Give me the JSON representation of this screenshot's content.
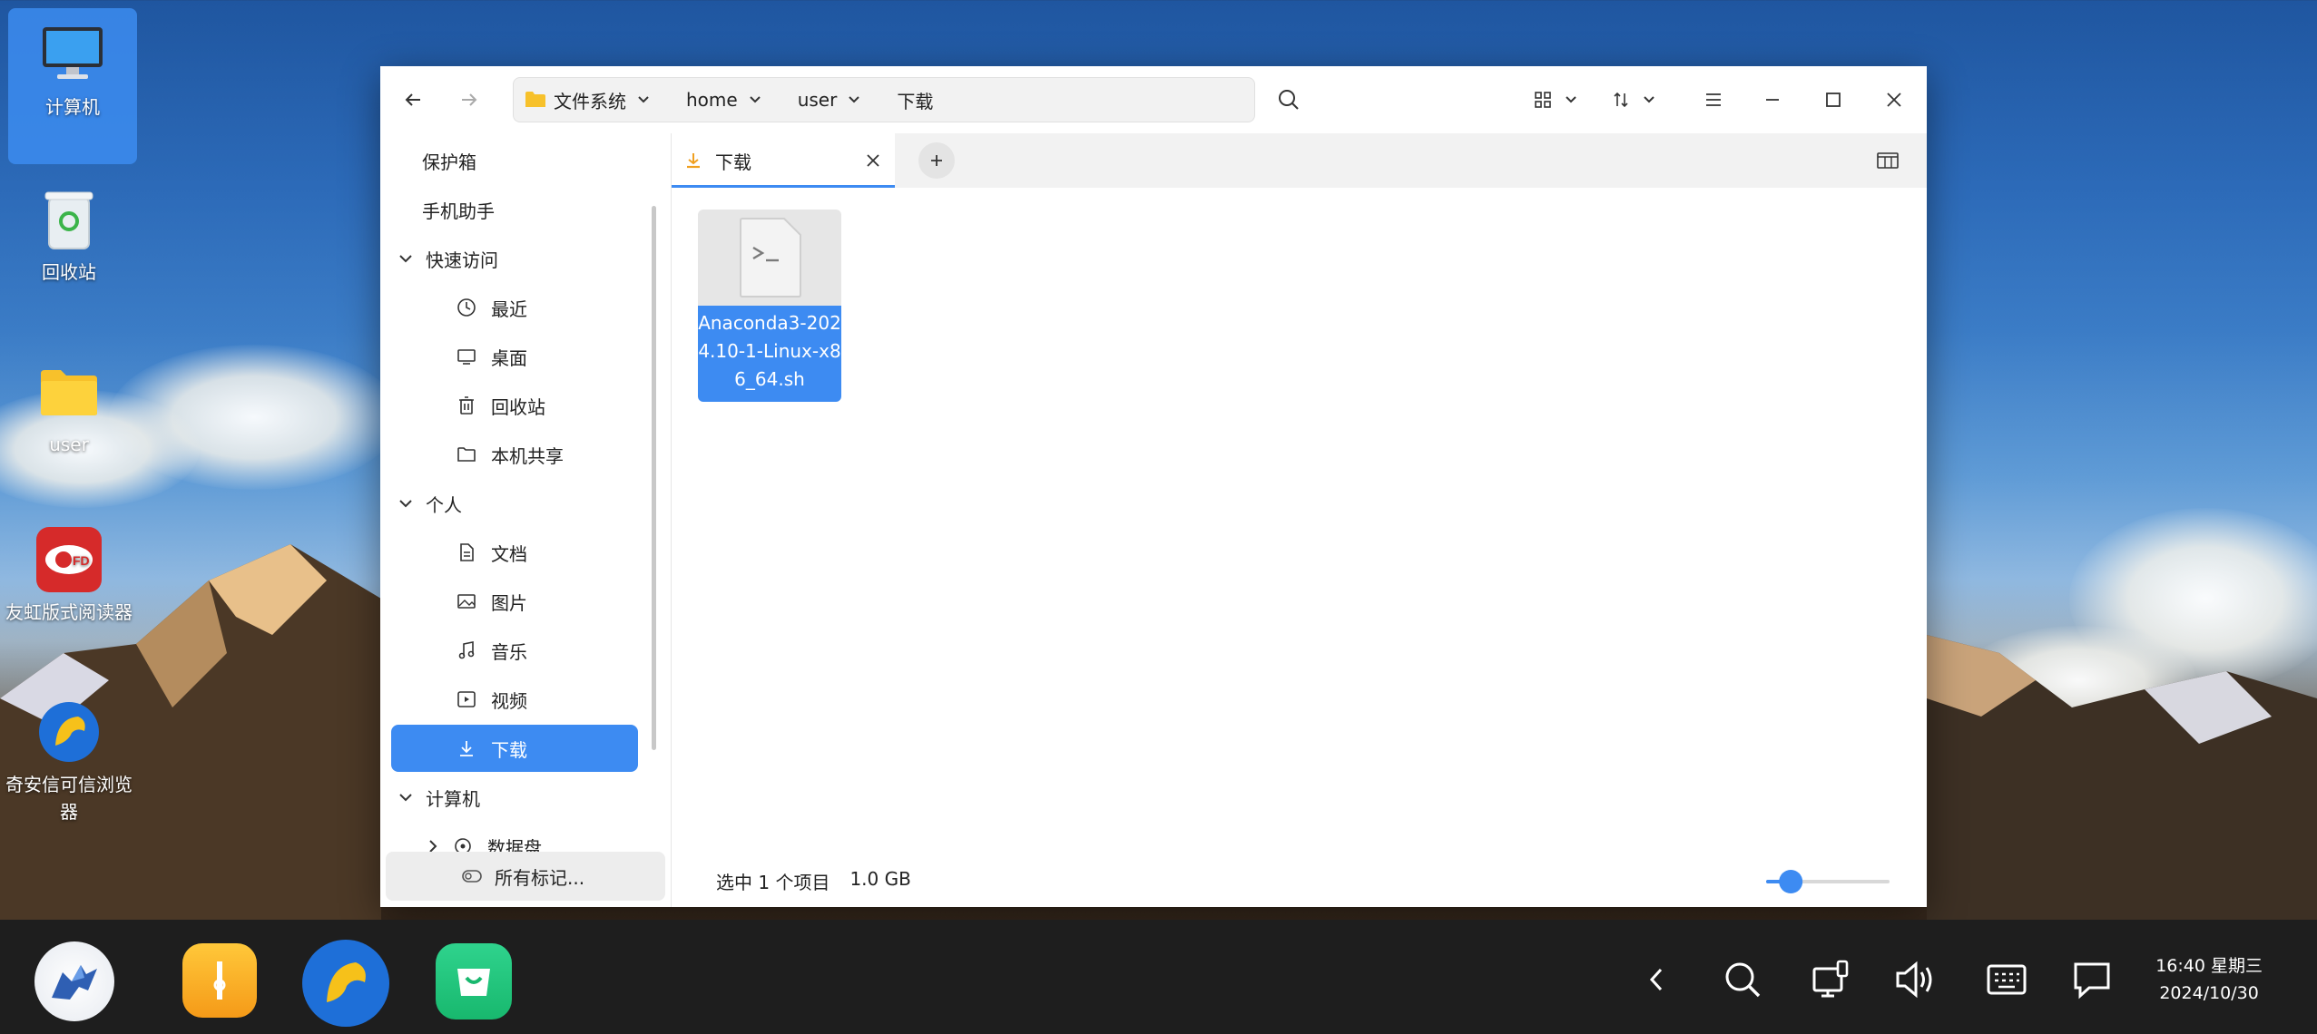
{
  "desktop": {
    "icons": [
      {
        "label": "计算机",
        "icon": "computer-icon"
      },
      {
        "label": "回收站",
        "icon": "trash-icon"
      },
      {
        "label": "user",
        "icon": "folder-icon"
      },
      {
        "label": "友虹版式阅读器",
        "icon": "ofd-reader-icon"
      },
      {
        "label": "奇安信可信浏览器",
        "icon": "browser-icon"
      }
    ]
  },
  "window": {
    "breadcrumbs": [
      "文件系统",
      "home",
      "user",
      "下载"
    ],
    "sidebar": {
      "items": [
        {
          "label": "保护箱"
        },
        {
          "label": "手机助手"
        },
        {
          "label": "快速访问",
          "section": true
        },
        {
          "label": "最近",
          "icon": "clock-icon"
        },
        {
          "label": "桌面",
          "icon": "desktop-icon"
        },
        {
          "label": "回收站",
          "icon": "trash-icon"
        },
        {
          "label": "本机共享",
          "icon": "folder-icon"
        },
        {
          "label": "个人",
          "section": true
        },
        {
          "label": "文档",
          "icon": "document-icon"
        },
        {
          "label": "图片",
          "icon": "image-icon"
        },
        {
          "label": "音乐",
          "icon": "music-icon"
        },
        {
          "label": "视频",
          "icon": "video-icon"
        },
        {
          "label": "下载",
          "icon": "download-icon",
          "active": true
        },
        {
          "label": "计算机",
          "section": true
        },
        {
          "label": "数据盘",
          "icon": "disk-icon"
        }
      ],
      "bottom_label": "所有标记..."
    },
    "tab": {
      "label": "下载"
    },
    "files": [
      {
        "name": "Anaconda3-2024.10-1-Linux-x86_64.sh",
        "selected": true
      }
    ],
    "status": {
      "selection": "选中 1 个项目",
      "size": "1.0 GB"
    },
    "zoom_level": 0.2,
    "accent": "#3d8bf2"
  },
  "taskbar": {
    "apps": [
      "launcher-icon",
      "file-manager-icon",
      "browser-icon",
      "app-store-icon"
    ],
    "time": "16:40 星期三",
    "date": "2024/10/30"
  }
}
